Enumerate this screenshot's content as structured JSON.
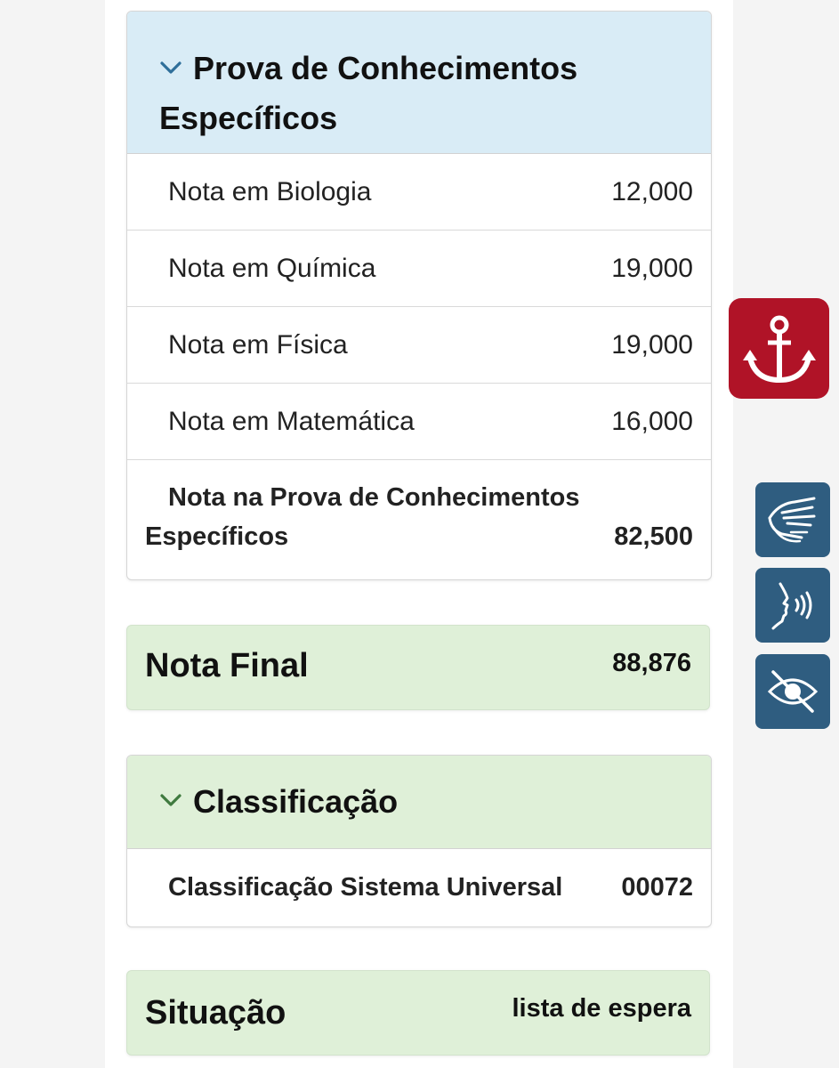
{
  "section_especificos": {
    "title_line1": "Prova de Conhecimentos",
    "title_line2": "Específicos",
    "rows": [
      {
        "label": "Nota em Biologia",
        "value": "12,000"
      },
      {
        "label": "Nota em Química",
        "value": "19,000"
      },
      {
        "label": "Nota em Física",
        "value": "19,000"
      },
      {
        "label": "Nota em Matemática",
        "value": "16,000"
      }
    ],
    "total": {
      "label_line1": "Nota na Prova de Conhecimentos",
      "label_line2": "Específicos",
      "value": "82,500"
    }
  },
  "nota_final": {
    "label": "Nota Final",
    "value": "88,876"
  },
  "classificacao": {
    "title": "Classificação",
    "row": {
      "label": "Classificação Sistema Universal",
      "value": "00072"
    }
  },
  "situacao": {
    "label": "Situação",
    "value": "lista de espera"
  },
  "side_buttons": {
    "anchor": {
      "icon": "anchor-icon",
      "color": "#b01327"
    },
    "libras": {
      "icon": "sign-language-hands-icon",
      "color": "#2f5d80"
    },
    "audio": {
      "icon": "speaking-head-icon",
      "color": "#2f5d80"
    },
    "contrast": {
      "icon": "eye-slash-icon",
      "color": "#2f5d80"
    }
  },
  "colors": {
    "heading_blue": "#d9ecf6",
    "heading_green": "#dff0d8",
    "chevron_blue": "#2f6f9a",
    "chevron_green": "#3f7a3f"
  }
}
